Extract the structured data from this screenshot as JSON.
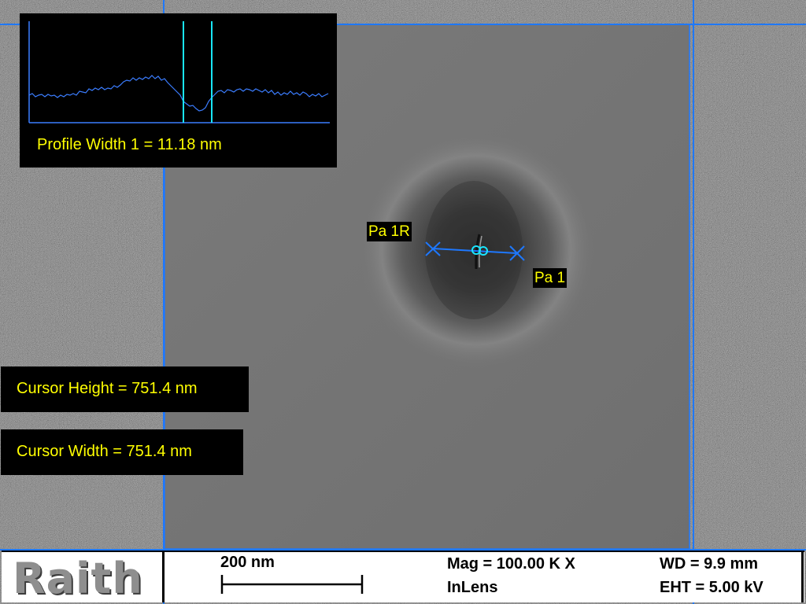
{
  "profile": {
    "label": "Profile Width 1 = 11.18 nm",
    "line_color": "#3b7dff",
    "cursor_color": "#19e6ff",
    "width_nm": 11.18
  },
  "cursor": {
    "height_label": "Cursor Height = 751.4 nm",
    "width_label": "Cursor Width = 751.4 nm",
    "height_nm": 751.4,
    "width_nm": 751.4
  },
  "markers": {
    "start_label": "Pa 1R",
    "end_label": "Pa 1"
  },
  "info_bar": {
    "logo_text": "Raith",
    "scale_label": "200 nm",
    "magnification": "Mag = 100.00 K X",
    "detector": "InLens",
    "working_distance": "WD =  9.9 mm",
    "eht": "EHT =  5.00 kV"
  },
  "colors": {
    "frame_lines": "#1e78ff",
    "label_text": "#ffff00",
    "measure_line": "#1e78ff"
  }
}
